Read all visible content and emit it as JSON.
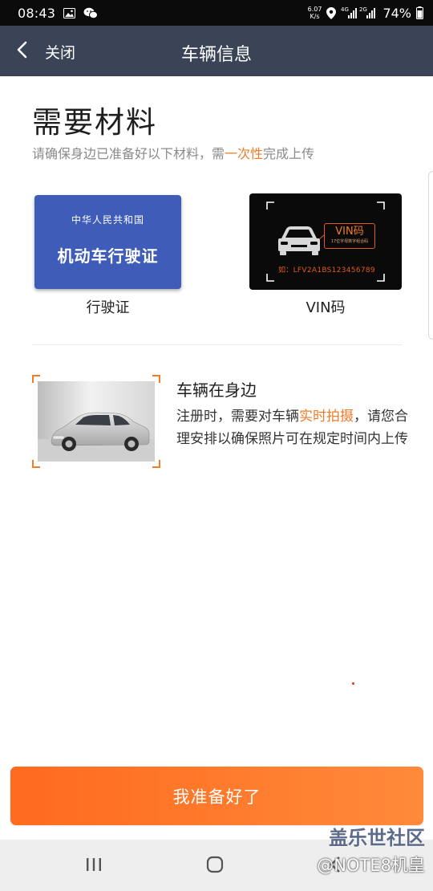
{
  "status_bar": {
    "time": "08:43",
    "net_speed_value": "6.07",
    "net_speed_unit": "K/s",
    "network_1": "4G",
    "network_2": "2G",
    "battery_percent": "74%",
    "icons": [
      "image-icon",
      "wechat-icon",
      "location-icon",
      "signal-icon",
      "battery-icon"
    ]
  },
  "header": {
    "back_label": "关闭",
    "title": "车辆信息",
    "background": "#3a4456"
  },
  "main": {
    "title": "需要材料",
    "subtitle_before": "请确保身边已准备好以下材料，需",
    "subtitle_highlight": "一次性",
    "subtitle_after": "完成上传",
    "materials": [
      {
        "label": "行驶证",
        "card_top_text": "中华人民共和国",
        "card_main_text": "机动车行驶证"
      },
      {
        "label": "VIN码",
        "tag_main": "VIN码",
        "tag_sub": "17位字母数字组合码",
        "example": "如：LFV2A1BS123456789"
      }
    ],
    "vehicle_section": {
      "title": "车辆在身边",
      "desc_before": "注册时，需要对车辆",
      "desc_highlight": "实时拍摄",
      "desc_after": "，请您合理安排以确保照片可在规定时间内上传"
    }
  },
  "primary_button": {
    "label": "我准备好了"
  },
  "nav_bar": {
    "items": [
      "recent-apps",
      "home",
      "back"
    ]
  },
  "watermark": {
    "line1": "盖乐世社区",
    "line2": "@NOTE8机皇"
  },
  "colors": {
    "accent": "#f07c2a",
    "button_start": "#ff6a1e",
    "button_end": "#ff8a3a",
    "license_blue": "#3e5cb8"
  }
}
